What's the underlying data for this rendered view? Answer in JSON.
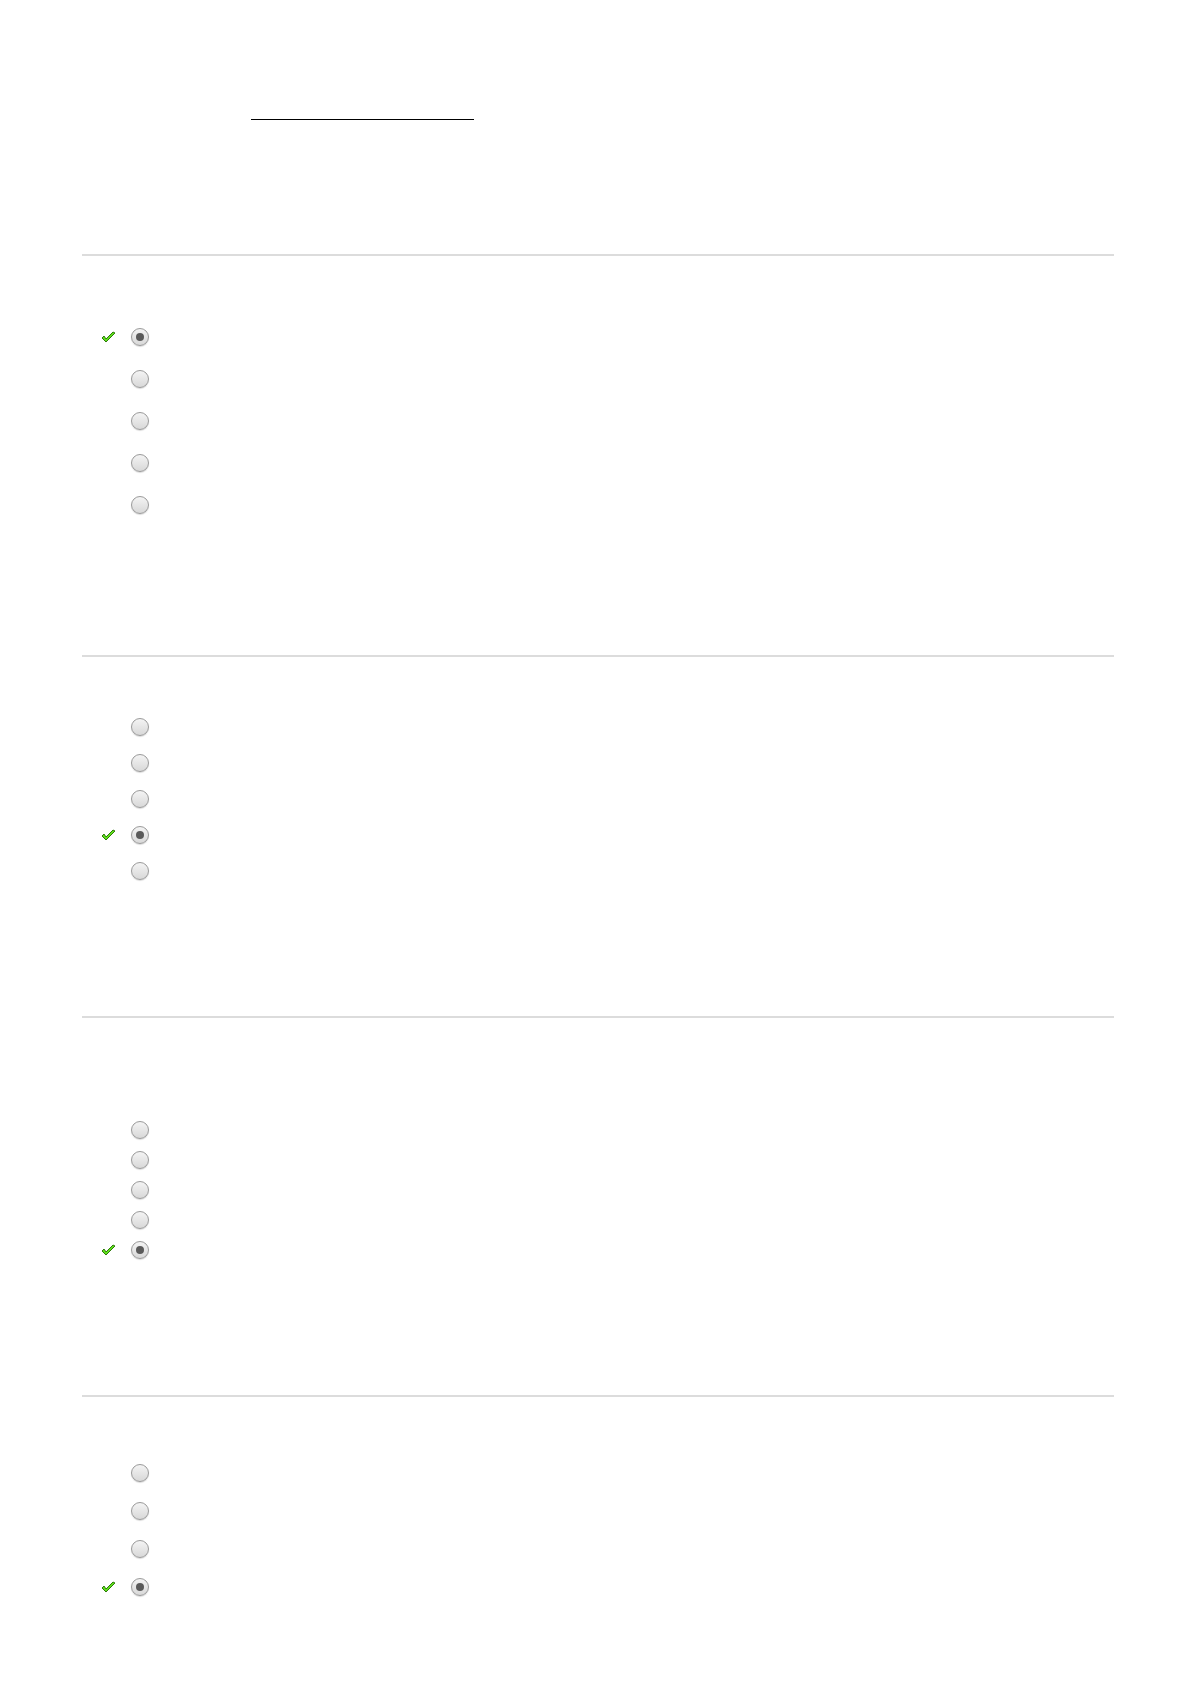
{
  "questions": [
    {
      "options": [
        {
          "selected": true,
          "correct": true
        },
        {
          "selected": false,
          "correct": false
        },
        {
          "selected": false,
          "correct": false
        },
        {
          "selected": false,
          "correct": false
        },
        {
          "selected": false,
          "correct": false
        }
      ]
    },
    {
      "options": [
        {
          "selected": false,
          "correct": false
        },
        {
          "selected": false,
          "correct": false
        },
        {
          "selected": false,
          "correct": false
        },
        {
          "selected": true,
          "correct": true
        },
        {
          "selected": false,
          "correct": false
        }
      ]
    },
    {
      "options": [
        {
          "selected": false,
          "correct": false
        },
        {
          "selected": false,
          "correct": false
        },
        {
          "selected": false,
          "correct": false
        },
        {
          "selected": false,
          "correct": false
        },
        {
          "selected": true,
          "correct": true
        }
      ]
    },
    {
      "options": [
        {
          "selected": false,
          "correct": false
        },
        {
          "selected": false,
          "correct": false
        },
        {
          "selected": false,
          "correct": false
        },
        {
          "selected": true,
          "correct": true
        }
      ]
    }
  ]
}
